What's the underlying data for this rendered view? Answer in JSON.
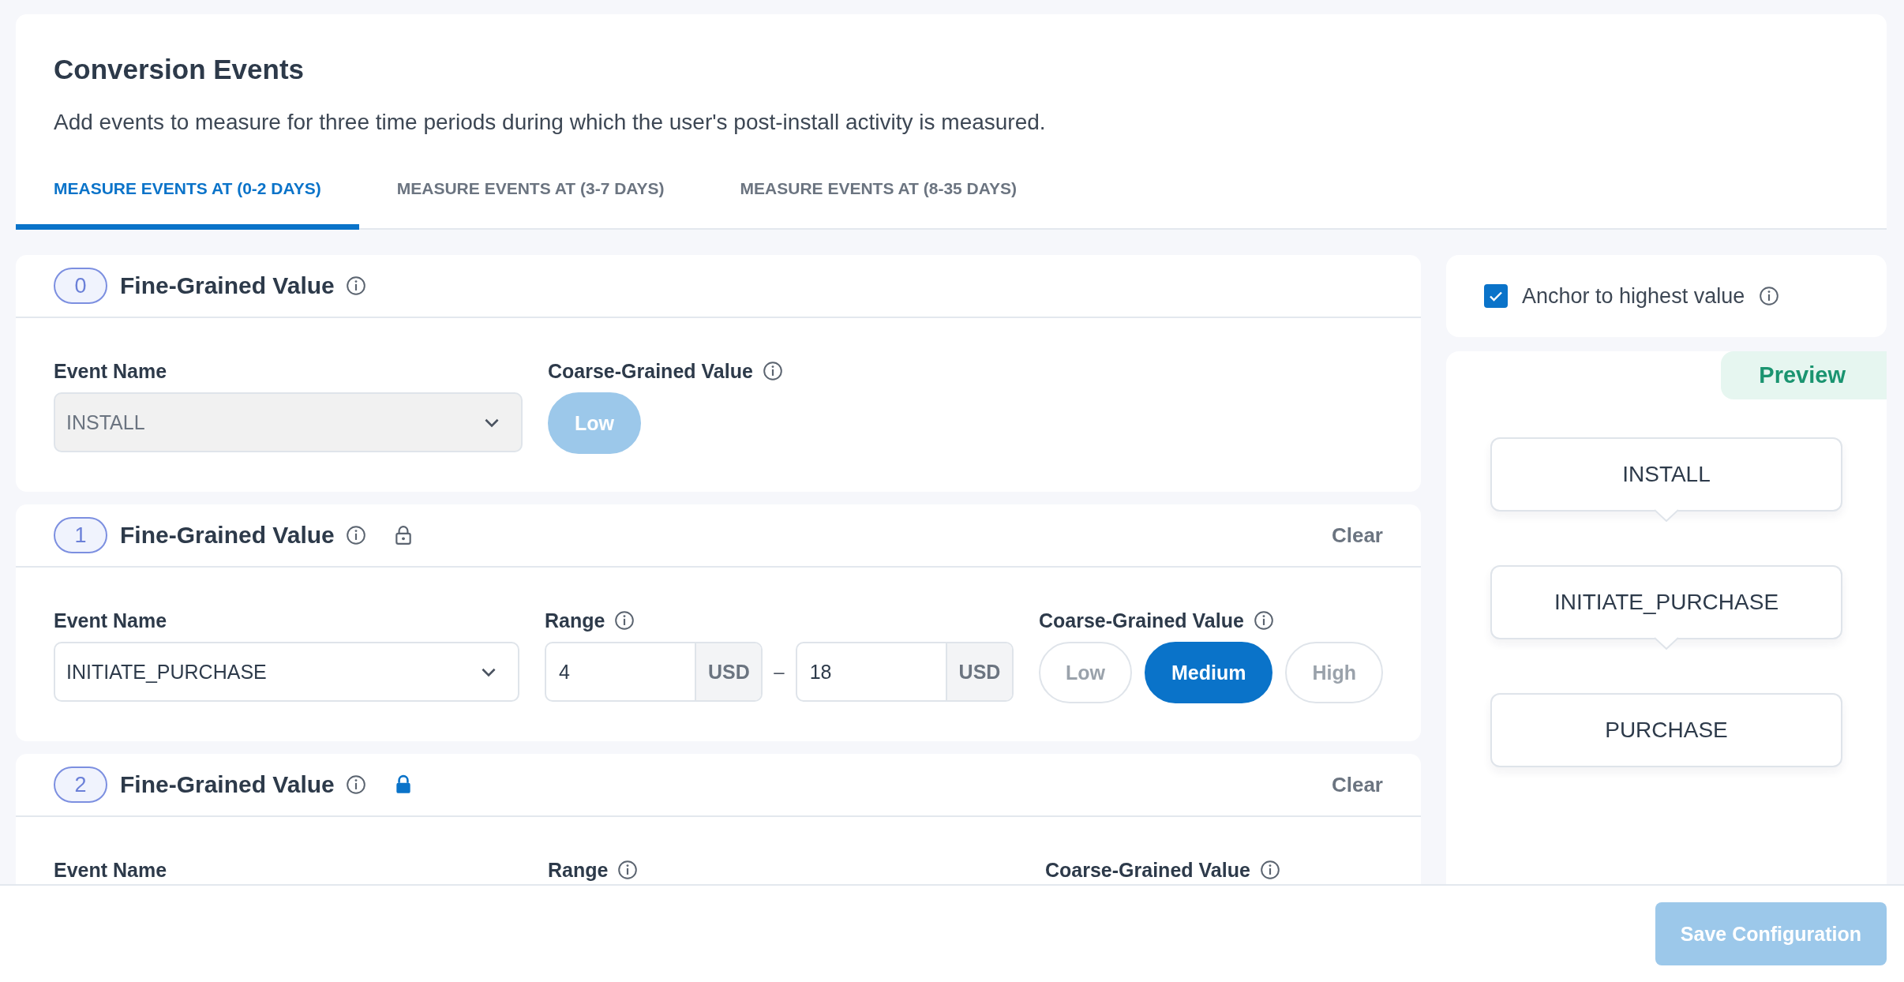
{
  "header": {
    "title": "Conversion Events",
    "description": "Add events to measure for three time periods during which the user's post-install activity is measured."
  },
  "tabs": [
    {
      "label": "MEASURE EVENTS AT (0-2 DAYS)",
      "selected": true
    },
    {
      "label": "MEASURE EVENTS AT (3-7 DAYS)",
      "selected": false
    },
    {
      "label": "MEASURE EVENTS AT (8-35 DAYS)",
      "selected": false
    }
  ],
  "cards": [
    {
      "number": "0",
      "title": "Fine-Grained Value",
      "fields": [
        {
          "kind": "event",
          "label": "Event Name",
          "value": "INSTALL",
          "disabled": true
        },
        {
          "kind": "coarse",
          "label": "Coarse-Grained Value",
          "disabled": true,
          "options": [
            {
              "label": "Low",
              "selected": true
            }
          ]
        }
      ]
    },
    {
      "number": "1",
      "title": "Fine-Grained Value",
      "locked": false,
      "clear": "Clear",
      "fields": [
        {
          "kind": "event",
          "label": "Event Name",
          "value": "INITIATE_PURCHASE",
          "disabled": false
        },
        {
          "kind": "range",
          "label": "Range",
          "from": "4",
          "from_unit": "USD",
          "separator": "–",
          "to": "18",
          "to_unit": "USD"
        },
        {
          "kind": "coarse",
          "label": "Coarse-Grained Value",
          "disabled": false,
          "options": [
            {
              "label": "Low",
              "selected": false
            },
            {
              "label": "Medium",
              "selected": true
            },
            {
              "label": "High",
              "selected": false
            }
          ]
        }
      ]
    },
    {
      "number": "2",
      "title": "Fine-Grained Value",
      "locked": true,
      "clear": "Clear",
      "fields": [
        {
          "kind": "event",
          "label": "Event Name"
        },
        {
          "kind": "range",
          "label": "Range"
        },
        {
          "kind": "coarse",
          "label": "Coarse-Grained Value"
        }
      ]
    }
  ],
  "anchor": {
    "label": "Anchor to highest value",
    "checked": true
  },
  "preview": {
    "tag": "Preview",
    "nodes": [
      "INSTALL",
      "INITIATE_PURCHASE",
      "PURCHASE"
    ]
  },
  "footer": {
    "save": {
      "label": "Save Configuration",
      "disabled": true
    }
  }
}
